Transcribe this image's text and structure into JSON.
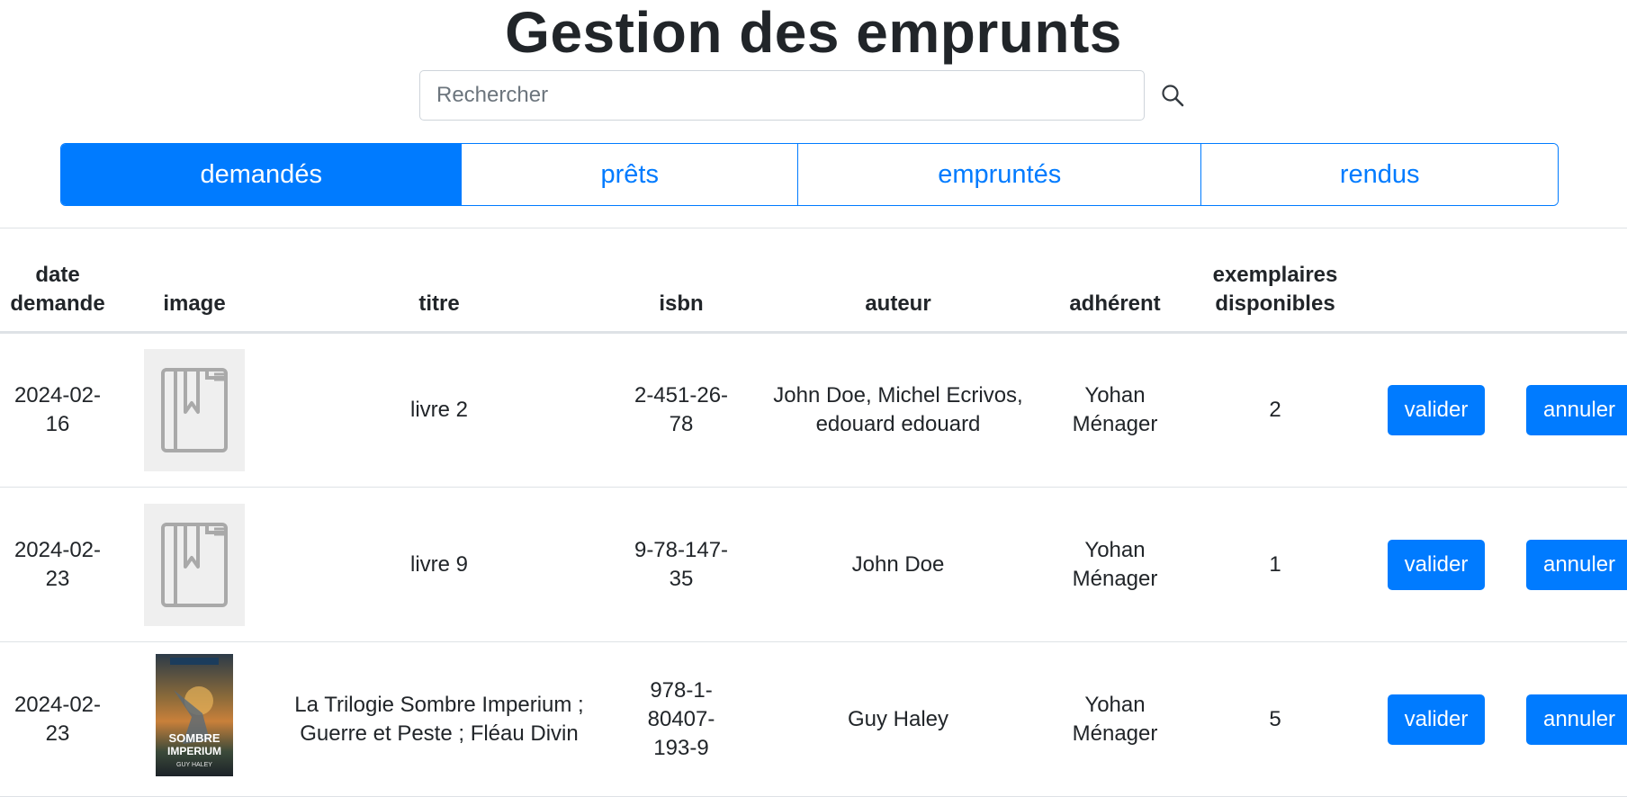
{
  "page": {
    "title": "Gestion des emprunts"
  },
  "search": {
    "placeholder": "Rechercher",
    "value": "",
    "icon": "search-icon"
  },
  "tabs": [
    {
      "label": "demandés",
      "active": true
    },
    {
      "label": "prêts",
      "active": false
    },
    {
      "label": "empruntés",
      "active": false
    },
    {
      "label": "rendus",
      "active": false
    }
  ],
  "table": {
    "headers": {
      "date": [
        "date",
        "demande"
      ],
      "image": "image",
      "title": "titre",
      "isbn": "isbn",
      "author": "auteur",
      "member": "adhérent",
      "copies": [
        "exemplaires",
        "disponibles"
      ]
    },
    "rows": [
      {
        "date": [
          "2024-02-",
          "16"
        ],
        "image": "book-placeholder-icon",
        "title": [
          "livre 2"
        ],
        "isbn": [
          "2-451-26-",
          "78"
        ],
        "author": [
          "John Doe, Michel Ecrivos,",
          "edouard edouard"
        ],
        "member": [
          "Yohan",
          "Ménager"
        ],
        "copies": "2",
        "validate": "valider",
        "cancel": "annuler"
      },
      {
        "date": [
          "2024-02-",
          "23"
        ],
        "image": "book-placeholder-icon",
        "title": [
          "livre 9"
        ],
        "isbn": [
          "9-78-147-",
          "35"
        ],
        "author": [
          "John Doe"
        ],
        "member": [
          "Yohan",
          "Ménager"
        ],
        "copies": "1",
        "validate": "valider",
        "cancel": "annuler"
      },
      {
        "date": [
          "2024-02-",
          "23"
        ],
        "image": "book-cover-image",
        "cover_text": [
          "SOMBRE",
          "IMPERIUM",
          "GUY HALEY"
        ],
        "title": [
          "La Trilogie Sombre Imperium ;",
          "Guerre et Peste ; Fléau Divin"
        ],
        "isbn": [
          "978-1-",
          "80407-",
          "193-9"
        ],
        "author": [
          "Guy Haley"
        ],
        "member": [
          "Yohan",
          "Ménager"
        ],
        "copies": "5",
        "validate": "valider",
        "cancel": "annuler"
      }
    ]
  },
  "colors": {
    "primary": "#007bff",
    "border": "#dee2e6",
    "text": "#212529"
  }
}
